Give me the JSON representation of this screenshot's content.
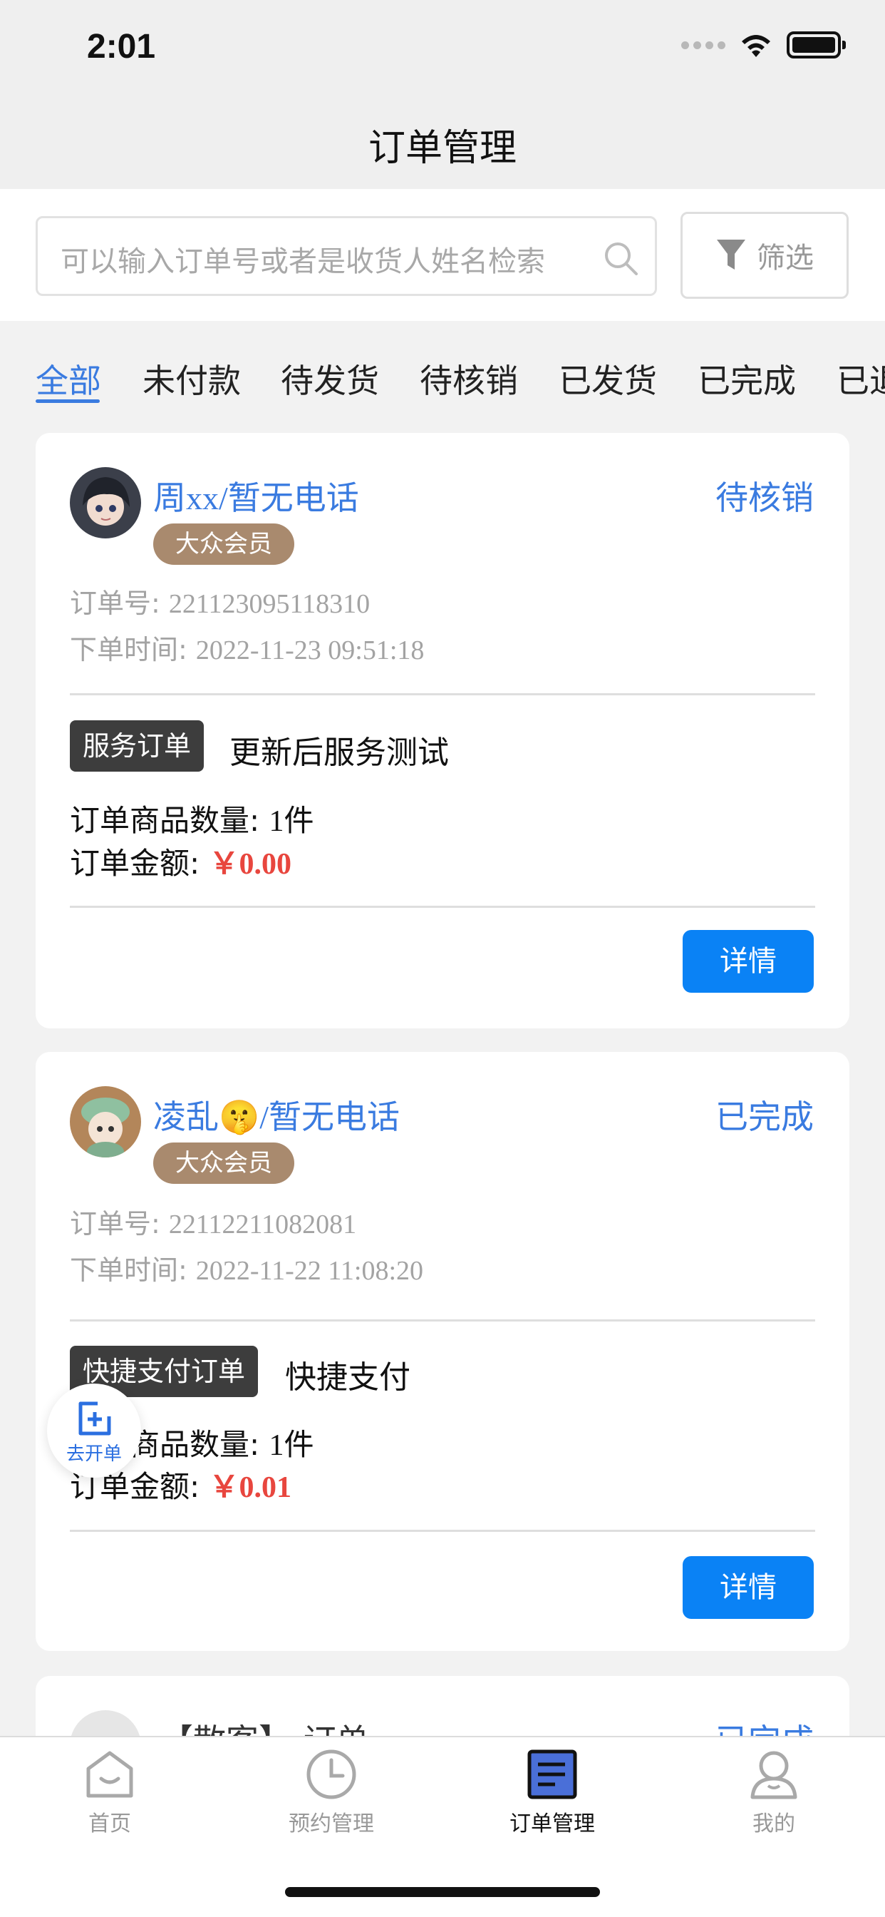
{
  "status_bar": {
    "time": "2:01"
  },
  "header": {
    "title": "订单管理"
  },
  "search": {
    "placeholder": "可以输入订单号或者是收货人姓名检索",
    "filter_label": "筛选"
  },
  "tabs": [
    {
      "label": "全部",
      "active": true
    },
    {
      "label": "未付款"
    },
    {
      "label": "待发货"
    },
    {
      "label": "待核销"
    },
    {
      "label": "已发货"
    },
    {
      "label": "已完成"
    },
    {
      "label": "已退"
    }
  ],
  "orders": [
    {
      "customer": "周xx/暂无电话",
      "status": "待核销",
      "member_level": "大众会员",
      "order_no_label": "订单号:",
      "order_no": "221123095118310",
      "time_label": "下单时间:",
      "time": "2022-11-23 09:51:18",
      "type_tag": "服务订单",
      "product": "更新后服务测试",
      "qty_label": "订单商品数量:",
      "qty": "1件",
      "amount_label": "订单金额:",
      "amount": "￥0.00",
      "detail_label": "详情"
    },
    {
      "customer": "凌乱🤫/暂无电话",
      "status": "已完成",
      "member_level": "大众会员",
      "order_no_label": "订单号:",
      "order_no": "22112211082081",
      "time_label": "下单时间:",
      "time": "2022-11-22 11:08:20",
      "type_tag": "快捷支付订单",
      "product": "快捷支付",
      "qty_label": "订单商品数量:",
      "qty": "1件",
      "amount_label": "订单金额:",
      "amount": "￥0.01",
      "detail_label": "详情"
    },
    {
      "customer": "【散客】-订单",
      "status": "已完成"
    }
  ],
  "fab": {
    "label": "去开单"
  },
  "tabbar": [
    {
      "label": "首页",
      "icon": "home-icon"
    },
    {
      "label": "预约管理",
      "icon": "clock-icon"
    },
    {
      "label": "订单管理",
      "icon": "order-list-icon",
      "active": true
    },
    {
      "label": "我的",
      "icon": "profile-icon"
    }
  ],
  "colors": {
    "accent": "#3a7be0",
    "button": "#0a82f5",
    "price": "#e8463e",
    "member_badge": "#a98a6e",
    "tag": "#3d3d3d"
  }
}
